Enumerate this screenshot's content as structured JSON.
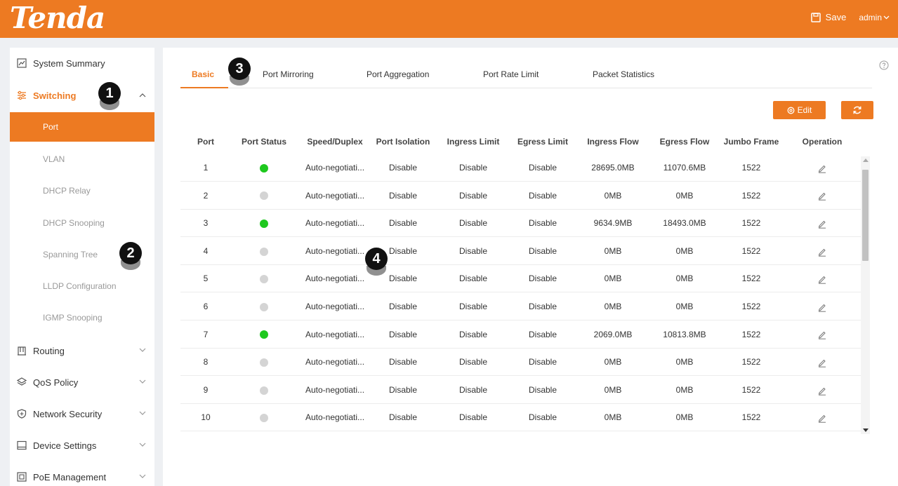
{
  "header": {
    "logo": "Tenda",
    "save_label": "Save",
    "user_label": "admin"
  },
  "sidebar": {
    "items": [
      {
        "label": "System Summary",
        "icon": "chart-icon"
      },
      {
        "label": "Switching",
        "icon": "sliders-icon",
        "expanded": true
      },
      {
        "label": "Routing",
        "icon": "routing-icon"
      },
      {
        "label": "QoS Policy",
        "icon": "layers-icon"
      },
      {
        "label": "Network Security",
        "icon": "shield-icon"
      },
      {
        "label": "Device Settings",
        "icon": "monitor-icon"
      },
      {
        "label": "PoE Management",
        "icon": "poe-icon"
      }
    ],
    "switching_sub": [
      "Port",
      "VLAN",
      "DHCP Relay",
      "DHCP Snooping",
      "Spanning Tree",
      "LLDP Configuration",
      "IGMP Snooping"
    ]
  },
  "tabs": [
    "Basic",
    "Port Mirroring",
    "Port Aggregation",
    "Port Rate Limit",
    "Packet Statistics"
  ],
  "buttons": {
    "edit_label": "Edit"
  },
  "table": {
    "columns": [
      "Port",
      "Port Status",
      "Speed/Duplex",
      "Port Isolation",
      "Ingress Limit",
      "Egress Limit",
      "Ingress Flow",
      "Egress Flow",
      "Jumbo Frame",
      "Operation"
    ],
    "rows": [
      {
        "port": "1",
        "status": "up",
        "speed": "Auto-negotiati...",
        "isolation": "Disable",
        "ingress_limit": "Disable",
        "egress_limit": "Disable",
        "ingress_flow": "28695.0MB",
        "egress_flow": "11070.6MB",
        "jumbo": "1522"
      },
      {
        "port": "2",
        "status": "down",
        "speed": "Auto-negotiati...",
        "isolation": "Disable",
        "ingress_limit": "Disable",
        "egress_limit": "Disable",
        "ingress_flow": "0MB",
        "egress_flow": "0MB",
        "jumbo": "1522"
      },
      {
        "port": "3",
        "status": "up",
        "speed": "Auto-negotiati...",
        "isolation": "Disable",
        "ingress_limit": "Disable",
        "egress_limit": "Disable",
        "ingress_flow": "9634.9MB",
        "egress_flow": "18493.0MB",
        "jumbo": "1522"
      },
      {
        "port": "4",
        "status": "down",
        "speed": "Auto-negotiati...",
        "isolation": "Disable",
        "ingress_limit": "Disable",
        "egress_limit": "Disable",
        "ingress_flow": "0MB",
        "egress_flow": "0MB",
        "jumbo": "1522"
      },
      {
        "port": "5",
        "status": "down",
        "speed": "Auto-negotiati...",
        "isolation": "Disable",
        "ingress_limit": "Disable",
        "egress_limit": "Disable",
        "ingress_flow": "0MB",
        "egress_flow": "0MB",
        "jumbo": "1522"
      },
      {
        "port": "6",
        "status": "down",
        "speed": "Auto-negotiati...",
        "isolation": "Disable",
        "ingress_limit": "Disable",
        "egress_limit": "Disable",
        "ingress_flow": "0MB",
        "egress_flow": "0MB",
        "jumbo": "1522"
      },
      {
        "port": "7",
        "status": "up",
        "speed": "Auto-negotiati...",
        "isolation": "Disable",
        "ingress_limit": "Disable",
        "egress_limit": "Disable",
        "ingress_flow": "2069.0MB",
        "egress_flow": "10813.8MB",
        "jumbo": "1522"
      },
      {
        "port": "8",
        "status": "down",
        "speed": "Auto-negotiati...",
        "isolation": "Disable",
        "ingress_limit": "Disable",
        "egress_limit": "Disable",
        "ingress_flow": "0MB",
        "egress_flow": "0MB",
        "jumbo": "1522"
      },
      {
        "port": "9",
        "status": "down",
        "speed": "Auto-negotiati...",
        "isolation": "Disable",
        "ingress_limit": "Disable",
        "egress_limit": "Disable",
        "ingress_flow": "0MB",
        "egress_flow": "0MB",
        "jumbo": "1522"
      },
      {
        "port": "10",
        "status": "down",
        "speed": "Auto-negotiati...",
        "isolation": "Disable",
        "ingress_limit": "Disable",
        "egress_limit": "Disable",
        "ingress_flow": "0MB",
        "egress_flow": "0MB",
        "jumbo": "1522"
      }
    ]
  },
  "callouts": [
    "1",
    "2",
    "3",
    "4"
  ],
  "colors": {
    "brand": "#ed7a22",
    "status_up": "#1ec81e",
    "status_down": "#d4d4d4"
  }
}
